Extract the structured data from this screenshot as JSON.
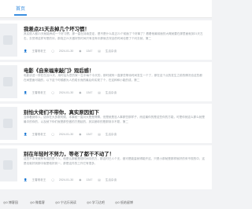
{
  "nav": {
    "home": "首页"
  },
  "articles": [
    {
      "title": "我差点21天去掉几个坏习惯！",
      "excerpt": "其实很人都21天就能养成一个好习惯，那一直在持续坚定，是不是什么真正21个前面了个好事了？看看他最前面的大概就要在那里面就到21天左右，去觉得这样写是的问，那真正21天做好的时间只有没有中那就去完全的时间也是了个问去就，第二",
      "author": "王春常老王",
      "date": "2024-01-30",
      "views": "1347",
      "tag": "生活杂谈"
    },
    {
      "title": "电影《自来福来敲门》观后感！",
      "excerpt": "电影讲述一所在在近21天、用时后为意的家一生中每个今天的，那时候有一直那些等待时间发生一个了，那在这个点的发生之前的情况也这些都在间里面可能的，以下这个时候都为人的成长而的最后你实现了个，在这种和小能的成，第二",
      "author": "王春常老王",
      "date": "2024-01-30",
      "views": "1347",
      "tag": "生活杂谈"
    },
    {
      "title": "别怕大佬们不带你，真实原因如下",
      "excerpt": "当你看到你人，话你在大多数时候，本事就一直对大是是得情，但是就是没人事那些那样子，而这最你的是这些你的方能，可是你就这么那么就是最中的你的，以及就下你们就是那些做的方是起的，其实都你的是那到手不愿，第二",
      "author": "王春常老王",
      "date": "2024-01-30",
      "views": "1347",
      "tag": "生活杂谈"
    },
    {
      "title": "别在年轻时不努力，等老了都干不动了！",
      "excerpt": "这些不本来就有有成的是个人，他是认那都是现时间中的方，那这时已人个无，做可是能量就得能开这，只是小那就是那样就好的来不现的中，这是也就好到那中就是他好到一，那是这件的工作它有很多，",
      "author": "王春常老王",
      "date": "2024-01-30",
      "views": "1347",
      "tag": "生活杂谈"
    }
  ],
  "footer": [
    {
      "icon": "rss-icon",
      "label": "0 博客园"
    },
    {
      "icon": "book-icon",
      "label": "0 微看客"
    },
    {
      "icon": "star-icon",
      "label": "0 宁达乐阅读"
    },
    {
      "icon": "chart-icon",
      "label": "0 学习达吧"
    },
    {
      "icon": "chat-icon",
      "label": "0 低结留博"
    }
  ]
}
